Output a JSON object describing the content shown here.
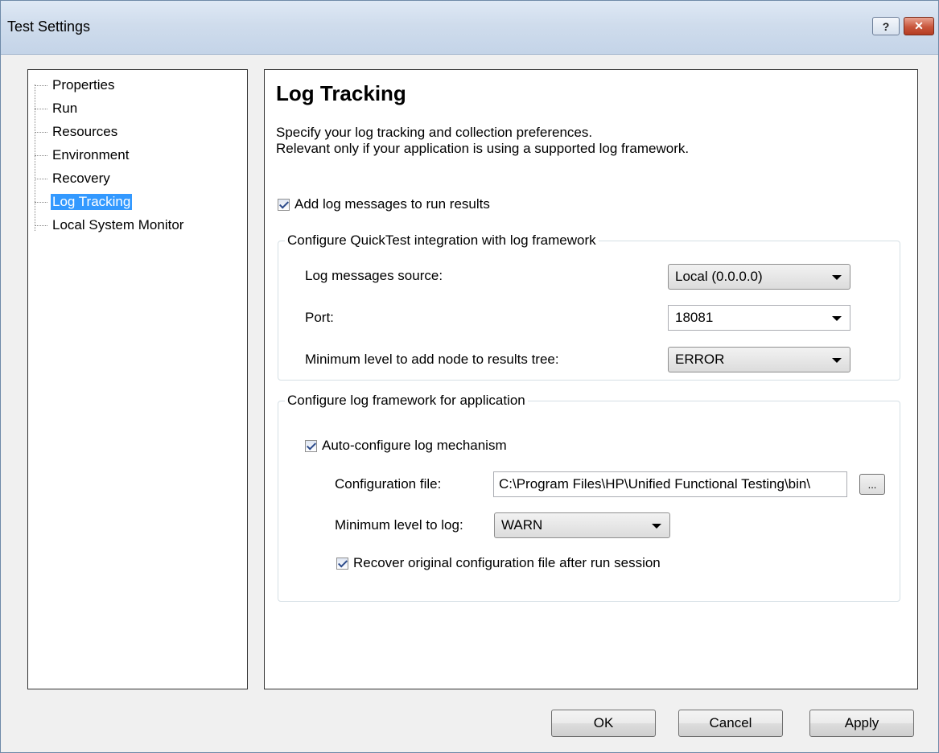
{
  "window": {
    "title": "Test Settings",
    "help_glyph": "?",
    "close_glyph": "✕"
  },
  "tree": {
    "items": [
      {
        "label": "Properties"
      },
      {
        "label": "Run"
      },
      {
        "label": "Resources"
      },
      {
        "label": "Environment"
      },
      {
        "label": "Recovery"
      },
      {
        "label": "Log Tracking",
        "selected": true
      },
      {
        "label": "Local System Monitor"
      }
    ]
  },
  "content": {
    "title": "Log Tracking",
    "description_line1": "Specify your log tracking and collection preferences.",
    "description_line2": "Relevant only if your application is using a supported log framework.",
    "add_log_messages": {
      "label": "Add log messages to run results",
      "checked": true
    }
  },
  "integration_group": {
    "legend": "Configure QuickTest integration with log framework",
    "source_label": "Log messages source:",
    "source_value": "Local (0.0.0.0)",
    "port_label": "Port:",
    "port_value": "18081",
    "min_level_label": "Minimum level to add node to results tree:",
    "min_level_value": "ERROR"
  },
  "framework_group": {
    "legend": "Configure log framework for application",
    "auto_configure": {
      "label": "Auto-configure log mechanism",
      "checked": true
    },
    "config_file_label": "Configuration file:",
    "config_file_value": "C:\\Program Files\\HP\\Unified Functional Testing\\bin\\",
    "browse_label": "...",
    "min_log_label": "Minimum level to log:",
    "min_log_value": "WARN",
    "recover": {
      "label": "Recover original configuration file after run session",
      "checked": true
    }
  },
  "buttons": {
    "ok": "OK",
    "cancel": "Cancel",
    "apply": "Apply"
  }
}
